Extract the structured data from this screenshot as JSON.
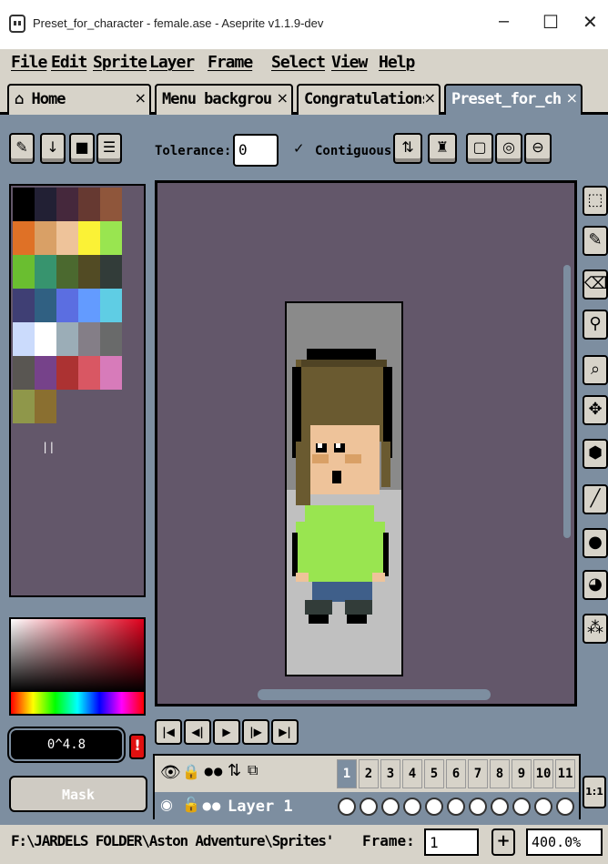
{
  "window": {
    "title": "Preset_for_character - female.ase - Aseprite v1.1.9-dev",
    "min": "–",
    "max": "☐",
    "close": "✕"
  },
  "menu": [
    "File",
    "Edit",
    "Sprite",
    "Layer",
    "Frame",
    "Select",
    "View",
    "Help"
  ],
  "tabs": [
    {
      "label": "Home",
      "icon": "home-icon"
    },
    {
      "label": "Menu backgrou"
    },
    {
      "label": "Congratulations"
    },
    {
      "label": "Preset_for_ch"
    }
  ],
  "tab_close": "×",
  "toolbar": {
    "tolerance_label": "Tolerance:",
    "tolerance_value": "0",
    "contiguous_label": "Contiguous",
    "contiguous_check": "✓"
  },
  "palette_colors": [
    "#000000",
    "#222034",
    "#45283c",
    "#663931",
    "#8f563b",
    "#df7126",
    "#d9a066",
    "#eec39a",
    "#fbf236",
    "#99e550",
    "#6abe30",
    "#37946e",
    "#4b692f",
    "#524b24",
    "#323c39",
    "#3f3f74",
    "#306082",
    "#5b6ee1",
    "#639bff",
    "#5fcde4",
    "#cbdbfc",
    "#ffffff",
    "#9badb7",
    "#847e87",
    "#696a6a",
    "#595652",
    "#76428a",
    "#ac3232",
    "#d95763",
    "#d77bba",
    "#8f974a",
    "#8a6f30"
  ],
  "color_hex": "0^4.8",
  "warning_icon": "!",
  "mask_label": "Mask",
  "playback": [
    "|◀",
    "◀|",
    "▶",
    "|▶",
    "▶|"
  ],
  "timeline": {
    "layer_name": "Layer 1",
    "frames": [
      "1",
      "2",
      "3",
      "4",
      "5",
      "6",
      "7",
      "8",
      "9",
      "10",
      "11"
    ],
    "selected_frame": "1"
  },
  "zoom_11": "1:1",
  "status": {
    "path": "F:\\JARDELS FOLDER\\Aston Adventure\\Sprites'",
    "frame_label": "Frame:",
    "frame_value": "1",
    "plus": "+",
    "zoom": "400.0%"
  },
  "accent_color": "#7d8ea0"
}
